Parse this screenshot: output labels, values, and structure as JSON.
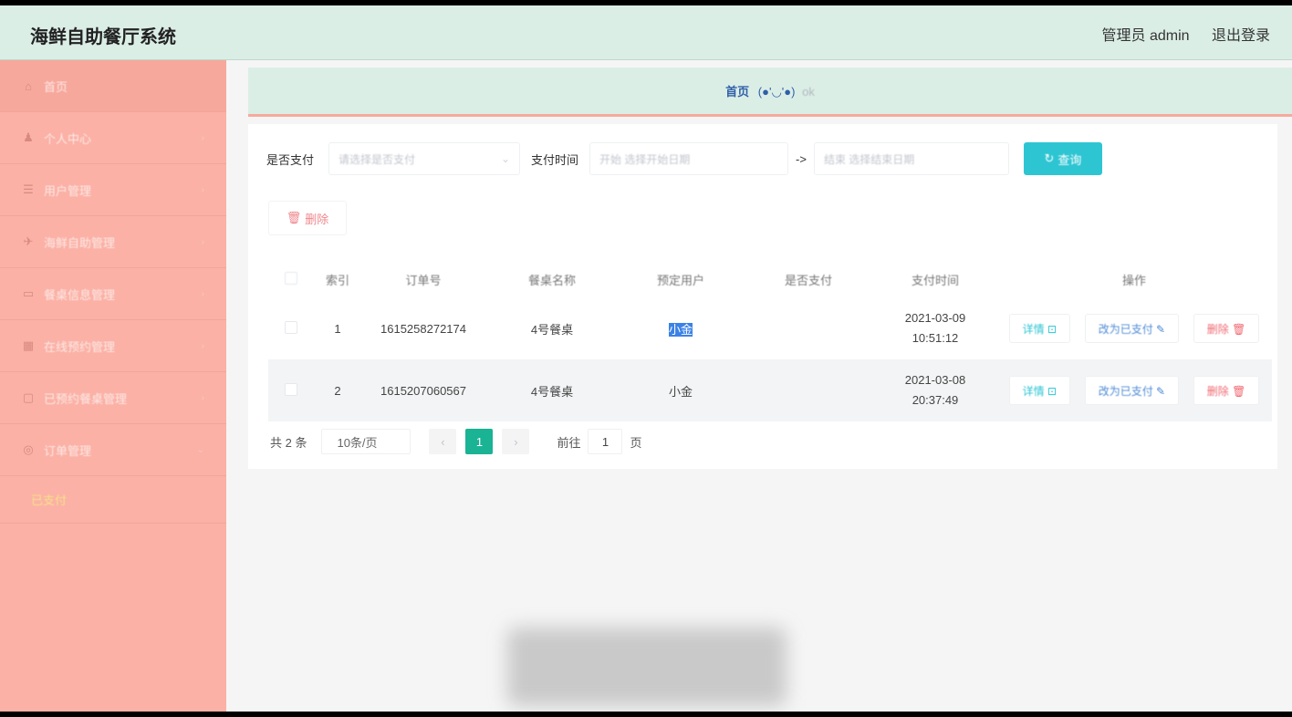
{
  "header": {
    "title": "海鲜自助餐厅系统",
    "user": "管理员 admin",
    "logout": "退出登录"
  },
  "sidebar": {
    "items": [
      {
        "label": "首页",
        "icon": "home-icon",
        "glyph": "⌂"
      },
      {
        "label": "个人中心",
        "icon": "person-icon",
        "glyph": "♟"
      },
      {
        "label": "用户管理",
        "icon": "list-icon",
        "glyph": "☰"
      },
      {
        "label": "海鲜自助管理",
        "icon": "plane-icon",
        "glyph": "✈"
      },
      {
        "label": "餐桌信息管理",
        "icon": "box-icon",
        "glyph": "▭"
      },
      {
        "label": "在线预约管理",
        "icon": "chart-icon",
        "glyph": "▦"
      },
      {
        "label": "已预约餐桌管理",
        "icon": "doc-icon",
        "glyph": "▢"
      },
      {
        "label": "订单管理",
        "icon": "cart-icon",
        "glyph": "◎"
      }
    ],
    "sub_item": "已支付"
  },
  "breadcrumb": {
    "home": "首页",
    "face": "(●'◡'●)",
    "ok": "ok"
  },
  "filters": {
    "paid_label": "是否支付",
    "paid_placeholder": "请选择是否支付",
    "time_label": "支付时间",
    "start_placeholder": "开始 选择开始日期",
    "separator": "->",
    "end_placeholder": "结束 选择结束日期",
    "search_button": "查询"
  },
  "toolbar": {
    "delete_button": "删除"
  },
  "table": {
    "columns": [
      "索引",
      "订单号",
      "餐桌名称",
      "预定用户",
      "是否支付",
      "支付时间",
      "操作"
    ],
    "rows": [
      {
        "index": "1",
        "order_no": "1615258272174",
        "table_name": "4号餐桌",
        "user": "小金",
        "paid": "",
        "pay_time": "2021-03-09 10:51:12"
      },
      {
        "index": "2",
        "order_no": "1615207060567",
        "table_name": "4号餐桌",
        "user": "小金",
        "paid": "",
        "pay_time": "2021-03-08 20:37:49"
      }
    ],
    "actions": {
      "detail": "详情",
      "mark_paid": "改为已支付",
      "delete": "删除"
    }
  },
  "pagination": {
    "total": "共 2 条",
    "page_size": "10条/页",
    "current_page": "1",
    "goto_label": "前往",
    "goto_value": "1",
    "page_suffix": "页"
  },
  "colors": {
    "sidebar": "#fbb1a6",
    "header": "#dbeee6",
    "accent": "#2ec5d3",
    "pager_active": "#1ab394"
  }
}
